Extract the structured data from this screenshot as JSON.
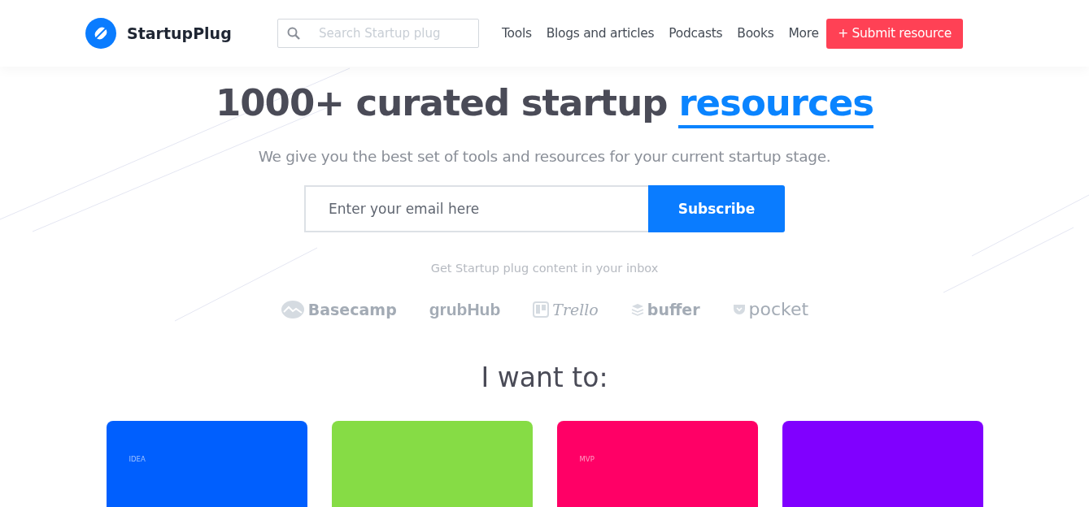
{
  "header": {
    "brand": "StartupPlug",
    "search": {
      "placeholder": "Search Startup plug"
    },
    "nav": [
      "Tools",
      "Blogs and articles",
      "Podcasts",
      "Books",
      "More"
    ],
    "cta": "+ Submit resource"
  },
  "hero": {
    "title": "1000+ curated startup",
    "title_highlight": "resources",
    "subtitle": "We give you the best set of tools and resources for your current startup stage.",
    "email": {
      "placeholder": "Enter your email here"
    },
    "subscribe": "Subscribe",
    "caption": "Get Startup plug content in your inbox",
    "logos": [
      {
        "kind": "basecamp",
        "label": "Basecamp"
      },
      {
        "kind": "grubhub",
        "label": "grubHub"
      },
      {
        "kind": "trello",
        "label": "Trello"
      },
      {
        "kind": "buffer",
        "label": "buffer"
      },
      {
        "kind": "pocket",
        "label": "pocket"
      }
    ]
  },
  "section": {
    "title": "I want to:",
    "cards": [
      {
        "tag": "IDEA",
        "color": "#005ffe"
      },
      {
        "color": "#86dc45"
      },
      {
        "tag": "MVP",
        "color": "#ff0066"
      },
      {
        "color": "#8000ff"
      }
    ]
  }
}
